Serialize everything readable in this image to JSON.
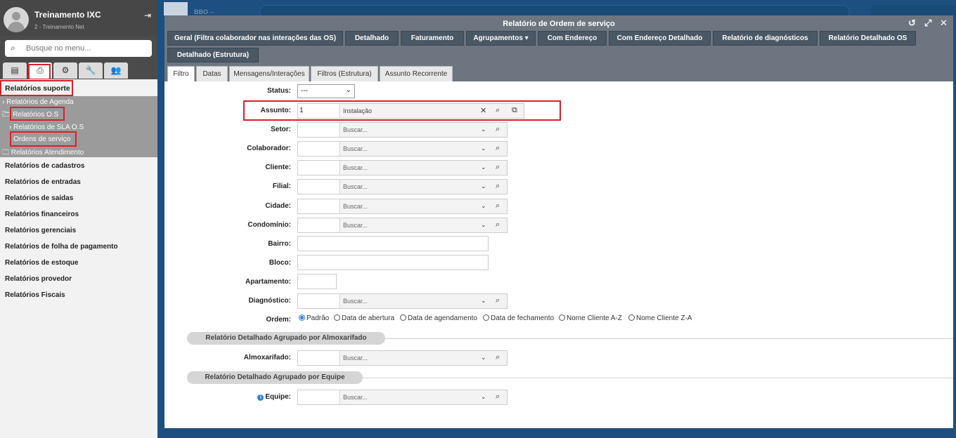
{
  "sidebar": {
    "user_name": "Treinamento IXC",
    "user_sub": "2 - Treinamento Net",
    "search_placeholder": "Busque no menu...",
    "section_title": "Relatórios suporte",
    "items": {
      "agenda": "Relatórios de Agenda",
      "os": "Relatórios O.S",
      "sla_os": "Relatórios de SLA O.S",
      "ordens": "Ordens de serviço",
      "atendimento": "Relatórios Atendimento",
      "cadastros": "Relatórios de cadastros",
      "entradas": "Relatórios de entradas",
      "saidas": "Relatórios de saídas",
      "financeiros": "Relatórios financeiros",
      "gerenciais": "Relatórios gerenciais",
      "folha": "Relatórios de folha de pagamento",
      "estoque": "Relatórios de estoque",
      "provedor": "Relatórios provedor",
      "fiscais": "Relatórios Fiscais"
    }
  },
  "background": {
    "logo_text": "BBO ─"
  },
  "window": {
    "title": "Relatório de Ordem de serviço",
    "buttons": {
      "geral": "Geral (Filtra colaborador nas interações das OS)",
      "detalhado": "Detalhado",
      "faturamento": "Faturamento",
      "agrupamentos": "Agrupamentos ▾",
      "com_endereco": "Com Endereço",
      "com_endereco_det": "Com Endereço Detalhado",
      "diagnosticos": "Relatório de diagnósticos",
      "detalhado_os": "Relatório Detalhado OS",
      "detalhado_estrutura": "Detalhado (Estrutura)"
    },
    "tabs": {
      "filtro": "Filtro",
      "datas": "Datas",
      "mensagens": "Mensagens/Interações",
      "filtros_estrutura": "Filtros (Estrutura)",
      "assunto_recorrente": "Assunto Recorrente"
    },
    "form": {
      "status_label": "Status:",
      "status_value": "---",
      "assunto_label": "Assunto:",
      "assunto_code": "1",
      "assunto_desc": "Instalação",
      "setor_label": "Setor:",
      "colaborador_label": "Colaborador:",
      "cliente_label": "Cliente:",
      "filial_label": "Filial:",
      "cidade_label": "Cidade:",
      "condominio_label": "Condomínio:",
      "bairro_label": "Bairro:",
      "bloco_label": "Bloco:",
      "apartamento_label": "Apartamento:",
      "diagnostico_label": "Diagnóstico:",
      "ordem_label": "Ordem:",
      "search_placeholder": "Buscar...",
      "ordem_options": {
        "padrao": "Padrão",
        "abertura": "Data de abertura",
        "agendamento": "Data de agendamento",
        "fechamento": "Data de fechamento",
        "nome_az": "Nome Cliente A-Z",
        "nome_za": "Nome Cliente Z-A"
      },
      "section_almox": "Relatório Detalhado Agrupado por Almoxarifado",
      "almoxarifado_label": "Almoxarifado:",
      "section_equipe": "Relatório Detalhado Agrupado por Equipe",
      "equipe_label": "Equipe:"
    }
  },
  "colors": {
    "highlight": "#d9202a",
    "window_bar": "#6d7680",
    "button": "#4a5866",
    "desktop": "#1d4f80"
  }
}
